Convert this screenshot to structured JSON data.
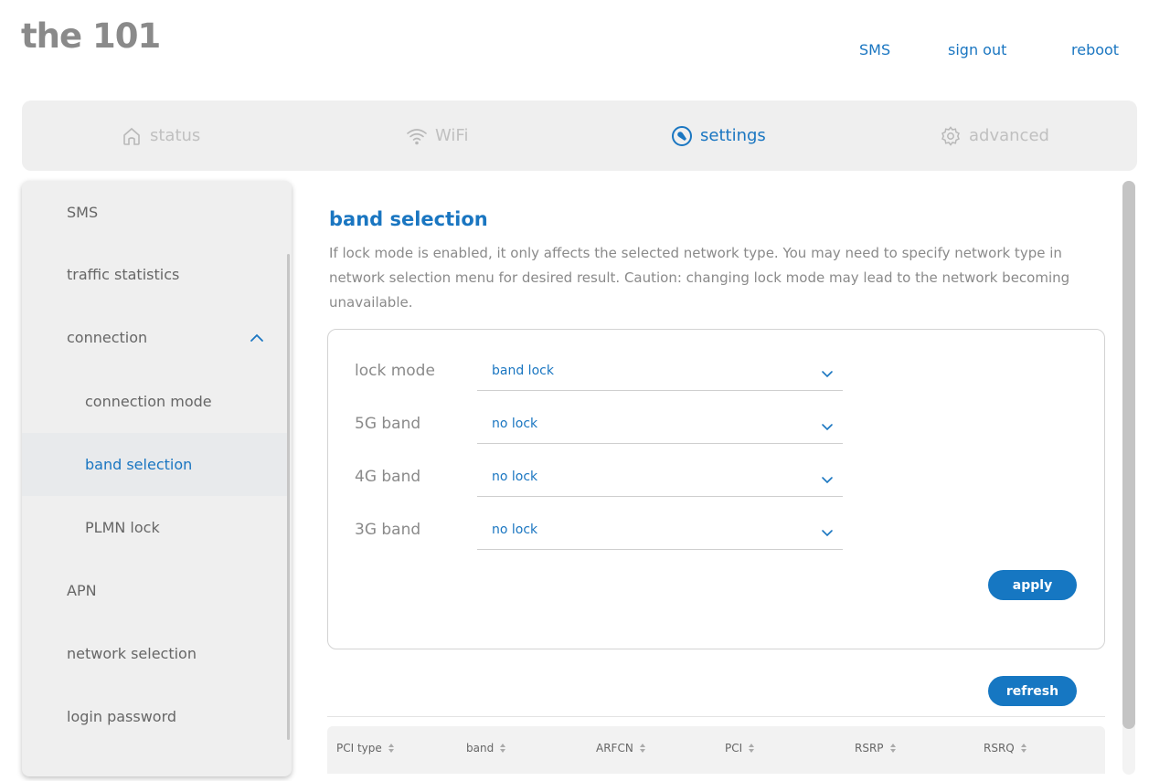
{
  "header": {
    "logo": "the 101",
    "links": {
      "sms": "SMS",
      "sign_out": "sign out",
      "reboot": "reboot"
    }
  },
  "nav": {
    "status": "status",
    "wifi": "WiFi",
    "settings": "settings",
    "advanced": "advanced"
  },
  "sidebar": {
    "items": [
      {
        "label": "SMS"
      },
      {
        "label": "traffic statistics"
      },
      {
        "label": "connection"
      },
      {
        "label": "connection mode"
      },
      {
        "label": "band selection"
      },
      {
        "label": "PLMN lock"
      },
      {
        "label": "APN"
      },
      {
        "label": "network selection"
      },
      {
        "label": "login password"
      }
    ]
  },
  "main": {
    "title": "band selection",
    "description": "If lock mode is enabled, it only affects the selected network type. You may need to specify network type in network selection menu for desired result. Caution: changing lock mode may lead to the network becoming unavailable.",
    "fields": [
      {
        "label": "lock mode",
        "value": "band lock"
      },
      {
        "label": "5G band",
        "value": "no lock"
      },
      {
        "label": "4G band",
        "value": "no lock"
      },
      {
        "label": "3G band",
        "value": "no lock"
      }
    ],
    "apply_label": "apply",
    "refresh_label": "refresh",
    "table": {
      "columns": [
        "PCI type",
        "band",
        "ARFCN",
        "PCI",
        "RSRP",
        "RSRQ"
      ]
    }
  },
  "colors": {
    "accent": "#1a76c1",
    "button": "#1677c2",
    "muted": "#8a8a8a"
  }
}
